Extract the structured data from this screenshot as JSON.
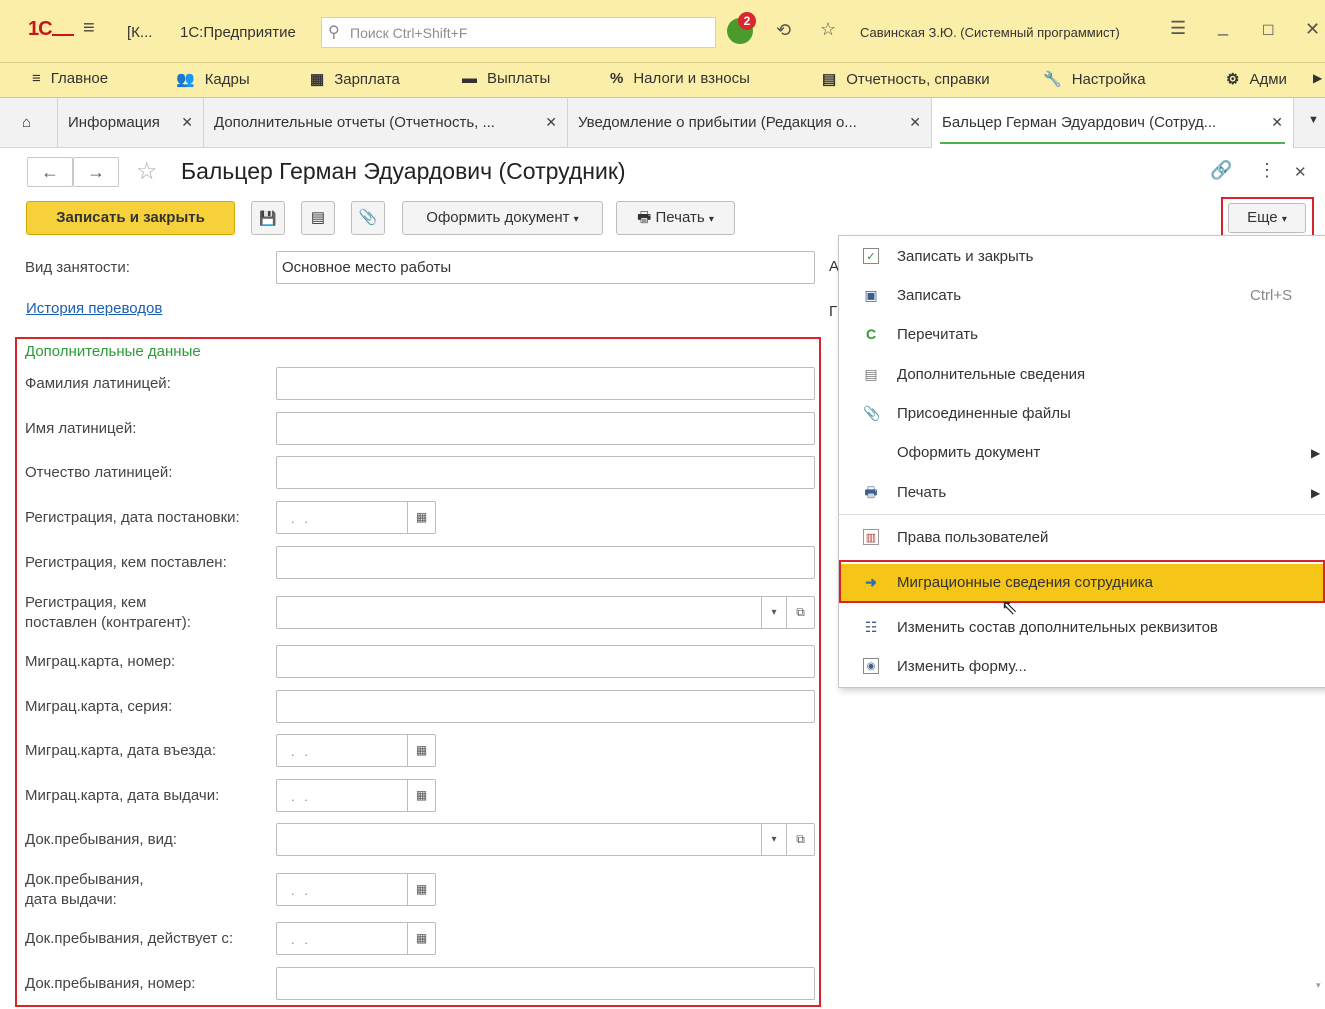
{
  "titlebar": {
    "logo": "1С",
    "short_title": "[К...",
    "app_title": "1С:Предприятие",
    "search_placeholder": "Поиск Ctrl+Shift+F",
    "notification_count": "2",
    "user": "Савинская З.Ю. (Системный программист)"
  },
  "sections": [
    {
      "label": "Главное",
      "icon": "menu-icon"
    },
    {
      "label": "Кадры",
      "icon": "people-icon"
    },
    {
      "label": "Зарплата",
      "icon": "calculator-icon"
    },
    {
      "label": "Выплаты",
      "icon": "wallet-icon"
    },
    {
      "label": "Налоги и взносы",
      "icon": "percent-icon"
    },
    {
      "label": "Отчетность, справки",
      "icon": "report-icon"
    },
    {
      "label": "Настройка",
      "icon": "wrench-icon"
    },
    {
      "label": "Адми",
      "icon": "gear-icon"
    }
  ],
  "tabs": [
    {
      "label": "Информация"
    },
    {
      "label": "Дополнительные отчеты (Отчетность, ..."
    },
    {
      "label": "Уведомление о прибытии (Редакция о..."
    },
    {
      "label": "Бальцер Герман Эдуардович (Сотруд..."
    }
  ],
  "form": {
    "title": "Бальцер Герман Эдуардович (Сотрудник)",
    "toolbar": {
      "save_close": "Записать и закрыть",
      "make_document": "Оформить документ",
      "print": "Печать",
      "more": "Еще"
    },
    "employment_label": "Вид занятости:",
    "employment_value": "Основное место работы",
    "history_link": "История переводов",
    "section_title": "Дополнительные данные",
    "fields": {
      "surname_lat": "Фамилия латиницей:",
      "name_lat": "Имя латиницей:",
      "patronymic_lat": "Отчество латиницей:",
      "reg_date": "Регистрация, дата постановки:",
      "reg_by": "Регистрация, кем поставлен:",
      "reg_by_contractor_1": "Регистрация, кем",
      "reg_by_contractor_2": "поставлен (контрагент):",
      "mig_card_number": "Миграц.карта, номер:",
      "mig_card_series": "Миграц.карта, серия:",
      "mig_card_entry": "Миграц.карта, дата въезда:",
      "mig_card_issue": "Миграц.карта, дата выдачи:",
      "stay_doc_type": "Док.пребывания, вид:",
      "stay_doc_issue_1": "Док.пребывания,",
      "stay_doc_issue_2": "дата выдачи:",
      "stay_doc_valid_from": "Док.пребывания, действует с:",
      "stay_doc_number": "Док.пребывания, номер:"
    },
    "date_placeholder": ". ."
  },
  "menu": {
    "items": [
      {
        "label": "Записать и закрыть",
        "icon": "check-doc-icon"
      },
      {
        "label": "Записать",
        "icon": "save-icon",
        "shortcut": "Ctrl+S"
      },
      {
        "label": "Перечитать",
        "icon": "refresh-icon"
      },
      {
        "label": "Дополнительные сведения",
        "icon": "doc-lines-icon"
      },
      {
        "label": "Присоединенные файлы",
        "icon": "paperclip-icon"
      },
      {
        "label": "Оформить документ",
        "icon": ""
      },
      {
        "label": "Печать",
        "icon": "printer-icon"
      },
      {
        "label": "Права пользователей",
        "icon": "rights-icon"
      },
      {
        "label": "Миграционные сведения сотрудника",
        "icon": "arrow-right-icon"
      },
      {
        "label": "Изменить состав дополнительных реквизитов",
        "icon": "attributes-icon"
      },
      {
        "label": "Изменить форму...",
        "icon": "form-settings-icon"
      }
    ]
  },
  "colors": {
    "accent_yellow": "#f7d13b",
    "highlight": "#f5c518",
    "titlebar_bg": "#fbeea8",
    "red_frame": "#d8232a",
    "section_green": "#2c9c3a",
    "link_blue": "#1a5fb4"
  }
}
